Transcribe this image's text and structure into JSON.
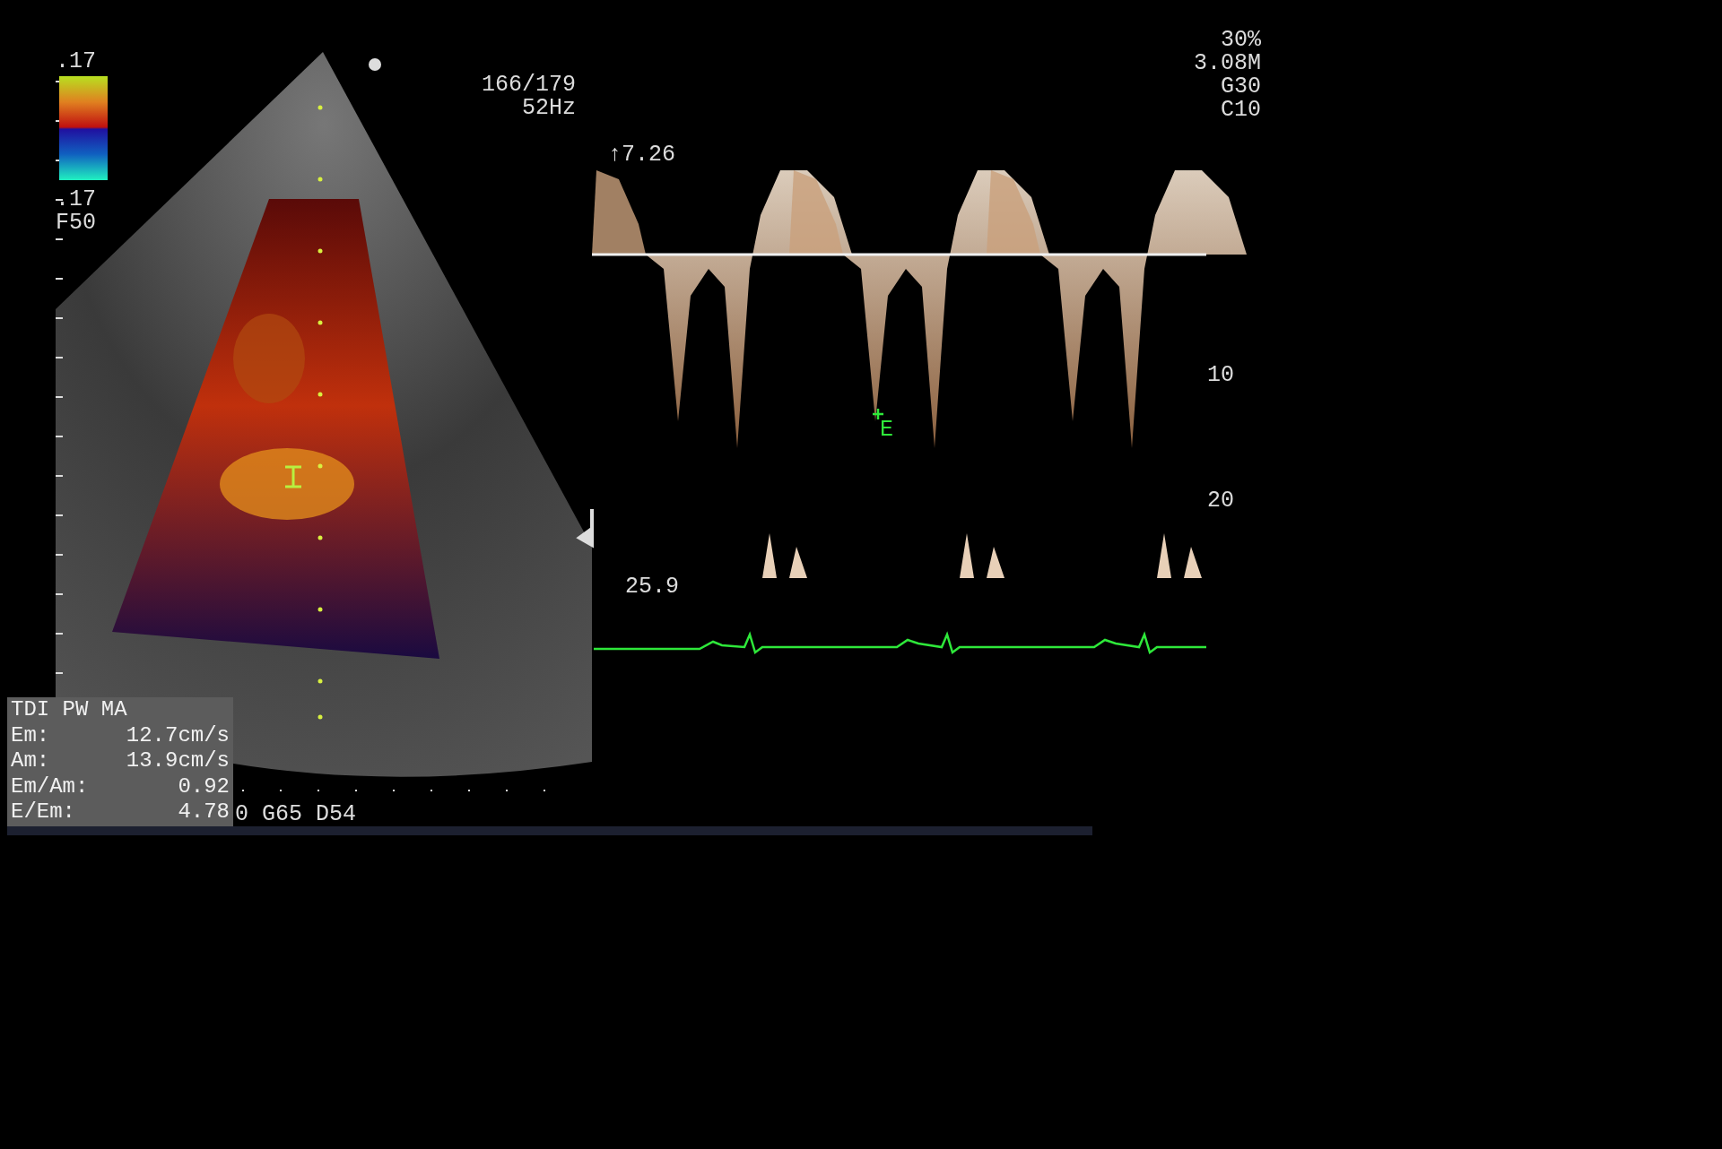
{
  "frame_info": {
    "frame": "166/179",
    "frame_rate": "52Hz"
  },
  "color_scale": {
    "top": ".17",
    "bottom": ".17",
    "filter": "F50"
  },
  "settings": [
    "30%",
    "3.08M",
    "G30",
    "C10"
  ],
  "spectral": {
    "scale_top": "↑7.26",
    "tick_labels": [
      "10",
      "20"
    ],
    "bottom_label": "25.9",
    "marker": "E"
  },
  "measurements": {
    "title": "TDI PW MA",
    "rows": [
      {
        "label": "Em:",
        "value": "12.7cm/s"
      },
      {
        "label": "Am:",
        "value": "13.9cm/s"
      },
      {
        "label": "Em/Am:",
        "value": "0.92"
      },
      {
        "label": "E/Em:",
        "value": "4.78"
      }
    ]
  },
  "image_settings": "0 G65 D54"
}
